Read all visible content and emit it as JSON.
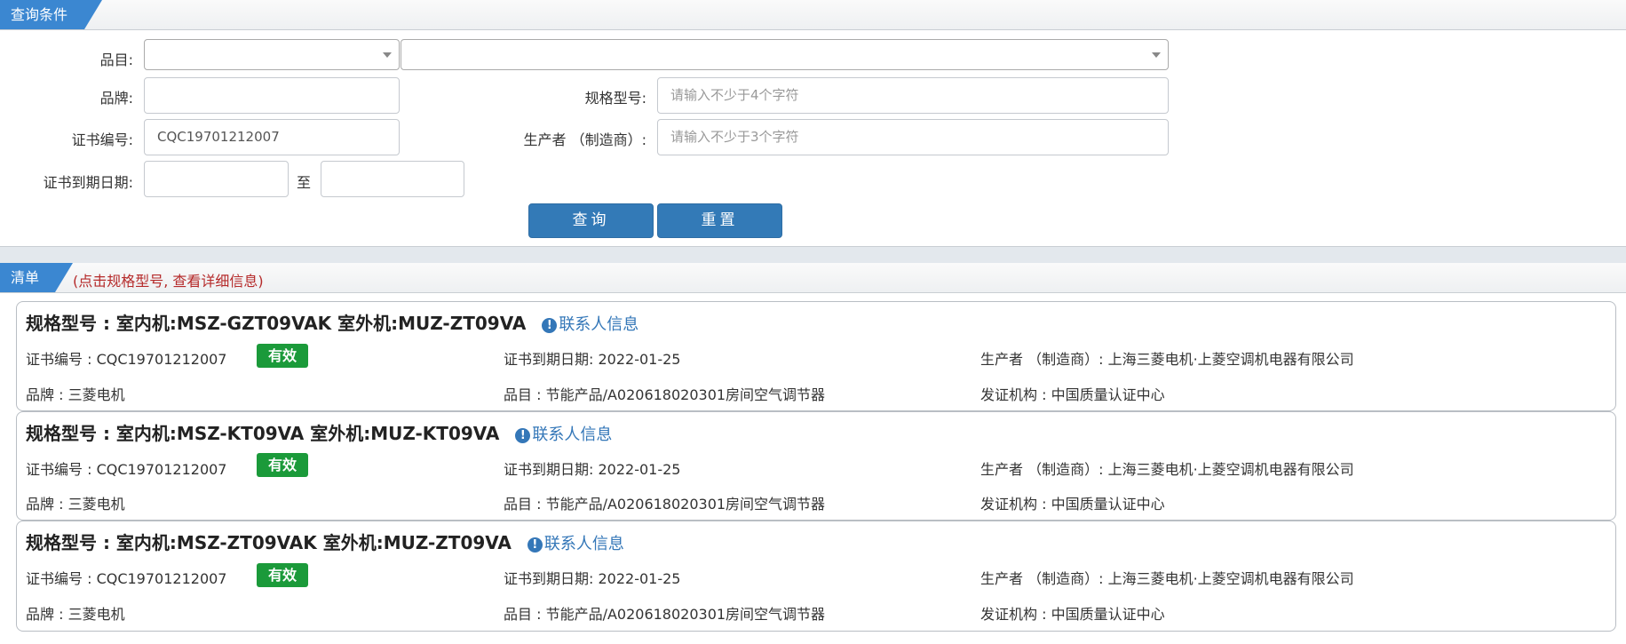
{
  "query_panel": {
    "title": "查询条件",
    "labels": {
      "category": "品目:",
      "brand": "品牌:",
      "model": "规格型号:",
      "cert_no": "证书编号:",
      "manufacturer": "生产者 （制造商）:",
      "expiry": "证书到期日期:",
      "to": "至"
    },
    "fields": {
      "category_main": "",
      "category_sub": "",
      "brand": "",
      "model_placeholder": "请输入不少于4个字符",
      "cert_no": "CQC19701212007",
      "manufacturer_placeholder": "请输入不少于3个字符",
      "expiry_from": "",
      "expiry_to": ""
    },
    "buttons": {
      "search": "查询",
      "reset": "重置"
    }
  },
  "list_panel": {
    "title": "清单",
    "note": "(点击规格型号, 查看详细信息)",
    "items": [
      {
        "title": "规格型号 : 室内机:MSZ-GZT09VAK 室外机:MUZ-ZT09VA",
        "contact": "联系人信息",
        "cert_no": "证书编号 : CQC19701212007",
        "status": "有效",
        "expiry": "证书到期日期: 2022-01-25",
        "manufacturer": "生产者 （制造商）: 上海三菱电机·上菱空调机电器有限公司",
        "brand": "品牌 : 三菱电机",
        "category": "品目 : 节能产品/A020618020301房间空气调节器",
        "issuer": "发证机构 : 中国质量认证中心"
      },
      {
        "title": "规格型号 : 室内机:MSZ-KT09VA 室外机:MUZ-KT09VA",
        "contact": "联系人信息",
        "cert_no": "证书编号 : CQC19701212007",
        "status": "有效",
        "expiry": "证书到期日期: 2022-01-25",
        "manufacturer": "生产者 （制造商）: 上海三菱电机·上菱空调机电器有限公司",
        "brand": "品牌 : 三菱电机",
        "category": "品目 : 节能产品/A020618020301房间空气调节器",
        "issuer": "发证机构 : 中国质量认证中心"
      },
      {
        "title": "规格型号 : 室内机:MSZ-ZT09VAK 室外机:MUZ-ZT09VA",
        "contact": "联系人信息",
        "cert_no": "证书编号 : CQC19701212007",
        "status": "有效",
        "expiry": "证书到期日期: 2022-01-25",
        "manufacturer": "生产者 （制造商）: 上海三菱电机·上菱空调机电器有限公司",
        "brand": "品牌 : 三菱电机",
        "category": "品目 : 节能产品/A020618020301房间空气调节器",
        "issuer": "发证机构 : 中国质量认证中心"
      }
    ]
  },
  "colors": {
    "accent": "#337ab7",
    "status_valid": "#1b9a3a",
    "note": "#b52a2a"
  }
}
